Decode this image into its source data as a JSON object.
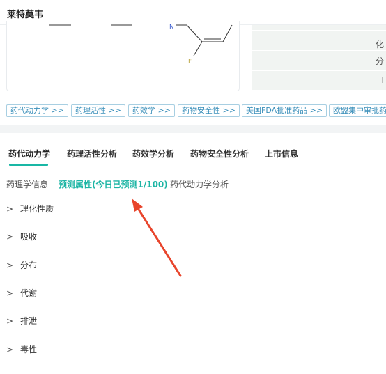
{
  "header": {
    "title": "莱特莫韦"
  },
  "structure": {
    "atom_n": "N",
    "atom_f": "F"
  },
  "props_panel": {
    "rows": [
      "化",
      "分",
      "I"
    ]
  },
  "tags": [
    "药代动力学 >>",
    "药理活性 >>",
    "药效学 >>",
    "药物安全性 >>",
    "美国FDA批准药品 >>",
    "欧盟集中审批药"
  ],
  "main_tabs": [
    "药代动力学",
    "药理活性分析",
    "药效学分析",
    "药物安全性分析",
    "上市信息"
  ],
  "sub_tabs": [
    "药理学信息",
    "预测属性(今日已预测1/100)",
    "药代动力学分析"
  ],
  "sections": [
    "理化性质",
    "吸收",
    "分布",
    "代谢",
    "排泄",
    "毒性"
  ],
  "colors": {
    "accent": "#1cb5a4",
    "tag_text": "#3a8fba",
    "arrow": "#e8452c"
  }
}
